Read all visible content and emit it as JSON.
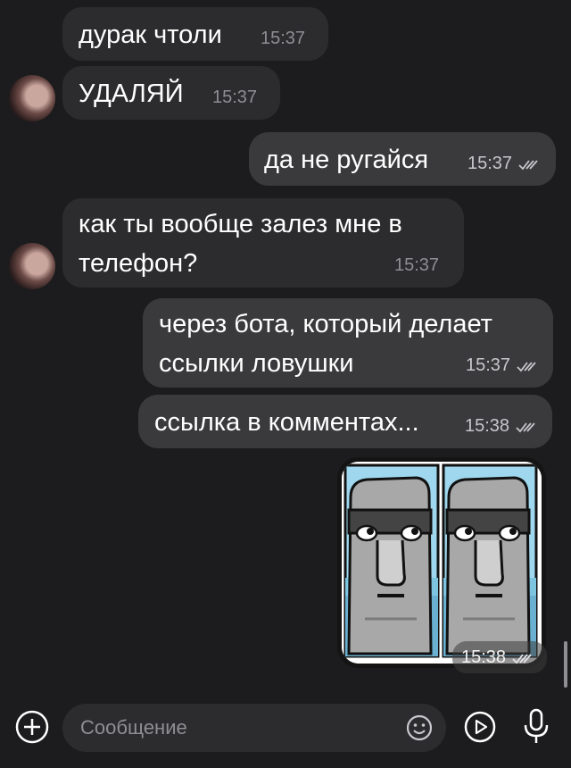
{
  "messages": [
    {
      "text": "дурак чтоли",
      "time": "15:37"
    },
    {
      "text": "УДАЛЯЙ",
      "time": "15:37"
    },
    {
      "text": "да не ругайся",
      "time": "15:37"
    },
    {
      "line1": "как ты вообще залез мне в",
      "line2": "телефон?",
      "time": "15:37"
    },
    {
      "line1": "через бота, который делает",
      "line2": "ссылки ловушки",
      "time": "15:37"
    },
    {
      "text": "ссылка в комментах...",
      "time": "15:38"
    }
  ],
  "sticker": {
    "time": "15:38",
    "icon": "moai-sticker"
  },
  "input": {
    "placeholder": "Сообщение"
  },
  "icons": {
    "attach": "plus-circle-icon",
    "emoji": "smile-icon",
    "video": "play-circle-icon",
    "mic": "microphone-icon",
    "read": "double-check-icon"
  },
  "colors": {
    "background": "#1c1c1e",
    "incoming": "#2c2c2e",
    "outgoing": "#3a3a3c",
    "time": "#8e8e93"
  }
}
